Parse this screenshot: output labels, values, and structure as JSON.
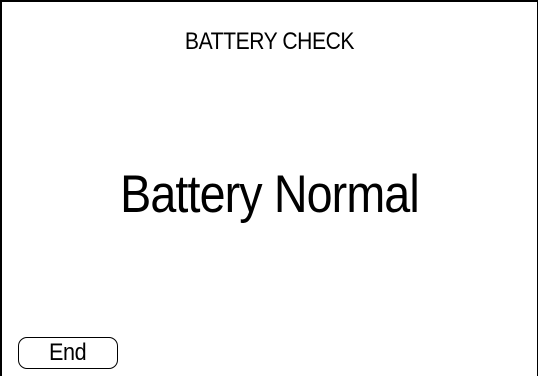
{
  "screen": {
    "title": "BATTERY CHECK",
    "status_message": "Battery Normal"
  },
  "buttons": {
    "end_label": "End"
  },
  "colors": {
    "background": "#ffffff",
    "foreground": "#000000"
  }
}
